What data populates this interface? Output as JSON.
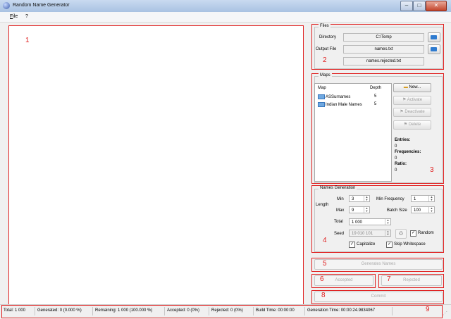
{
  "window": {
    "title": "Random Name Generator"
  },
  "menu": {
    "file": "File",
    "help": "?"
  },
  "annotations": {
    "n1": "1",
    "n2": "2",
    "n3": "3",
    "n4": "4",
    "n5": "5",
    "n6": "6",
    "n7": "7",
    "n8": "8",
    "n9": "9"
  },
  "files": {
    "title": "Files",
    "directory_label": "Directory",
    "directory_value": "C:\\Temp",
    "output_label": "Output File",
    "output_value": "names.txt",
    "rejected_value": "names.rejected.txt"
  },
  "maps": {
    "title": "Maps",
    "col_map": "Map",
    "col_depth": "Depth",
    "items": [
      {
        "name": "ASSurnames",
        "depth": "5"
      },
      {
        "name": "Indian Male Names",
        "depth": "5"
      }
    ],
    "btn_new": "New...",
    "btn_activate": "Activate",
    "btn_deactivate": "Deactivate",
    "btn_delete": "Delete",
    "entries_label": "Entries:",
    "entries_value": "0",
    "frequencies_label": "Frequencies:",
    "frequencies_value": "0",
    "ratio_label": "Ratio:",
    "ratio_value": "0"
  },
  "generation": {
    "title": "Names Generation",
    "length_label": "Length",
    "min_label": "Min",
    "min_value": "3",
    "max_label": "Max",
    "max_value": "9",
    "min_freq_label": "Min Frequency",
    "min_freq_value": "1",
    "batch_label": "Batch Size",
    "batch_value": "100",
    "total_label": "Total",
    "total_value": "1 000",
    "seed_label": "Seed",
    "seed_value": "19 010 101",
    "random_label": "Random",
    "capitalize_label": "Capitalize",
    "skip_label": "Skip Whitespace"
  },
  "actions": {
    "generate": "Generates Names",
    "accepted": "Accepted",
    "rejected": "Rejected",
    "commit": "Commit"
  },
  "status": {
    "total": "Total:  1 000",
    "generated": "Generated:  0 (0.000 %)",
    "remaining": "Remaining:  1 000 (100.000 %)",
    "accepted": "Accepted:  0 (0%)",
    "rejected": "Rejected:  0 (0%)",
    "build_time": "Build Time:  00:00:00",
    "generation_time": "Generation Time:  00:00:24.9834067"
  }
}
